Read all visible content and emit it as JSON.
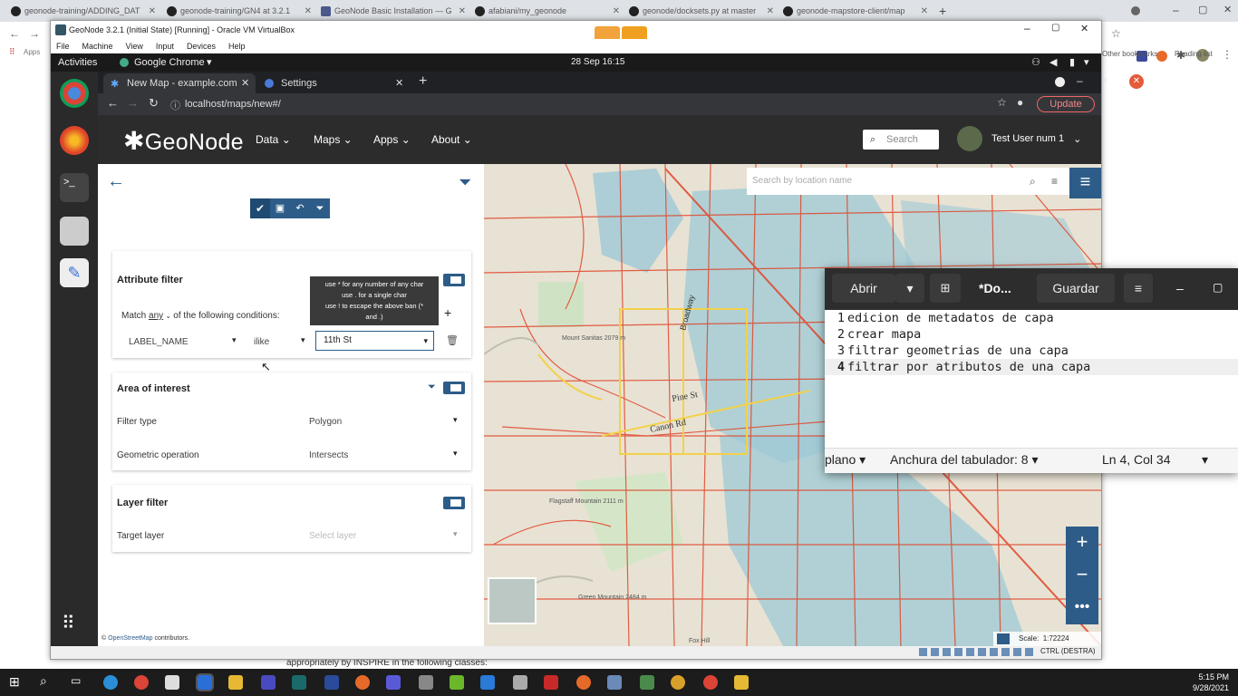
{
  "outer_tabs": [
    {
      "label": "geonode-training/ADDING_DAT"
    },
    {
      "label": "geonode-training/GN4 at 3.2.1"
    },
    {
      "label": "GeoNode Basic Installation — G"
    },
    {
      "label": "afabiani/my_geonode"
    },
    {
      "label": "geonode/docksets.py at master"
    },
    {
      "label": "geonode-mapstore-client/map"
    }
  ],
  "outer_bookmarks": {
    "apps": "Apps",
    "other": "Other bookmarks",
    "reading": "Reading list"
  },
  "vbox": {
    "title": "GeoNode 3.2.1 (Initial State) [Running] - Oracle VM VirtualBox",
    "menu": [
      "File",
      "Machine",
      "View",
      "Input",
      "Devices",
      "Help"
    ],
    "host_key": "CTRL (DESTRA)"
  },
  "gnome": {
    "activities": "Activities",
    "app": "Google Chrome",
    "datetime": "28 Sep  16:15"
  },
  "guest_chrome": {
    "tabs": [
      {
        "label": "New Map - example.com"
      },
      {
        "label": "Settings"
      }
    ],
    "url": "localhost/maps/new#/",
    "update": "Update"
  },
  "geonode": {
    "logo": "GeoNode",
    "nav": [
      "Data",
      "Maps",
      "Apps",
      "About"
    ],
    "search_placeholder": "Search",
    "user": "Test User num 1"
  },
  "filter_panel": {
    "attribute_filter": {
      "title": "Attribute filter",
      "match_prefix": "Match",
      "match_value": "any",
      "match_suffix": "of the following conditions:",
      "tooltip": [
        "use * for any number of any char",
        "use . for a single char",
        "use ! to escape the above ban (*",
        "and .)"
      ],
      "row": {
        "attribute": "LABEL_NAME",
        "operator": "ilike",
        "value": "11th St"
      }
    },
    "area_of_interest": {
      "title": "Area of interest",
      "filter_type_label": "Filter type",
      "filter_type_value": "Polygon",
      "geom_op_label": "Geometric operation",
      "geom_op_value": "Intersects"
    },
    "layer_filter": {
      "title": "Layer filter",
      "target_label": "Target layer",
      "target_placeholder": "Select layer"
    }
  },
  "map": {
    "search_placeholder": "Search by location name",
    "attribution_link": "OpenStreetMap",
    "attribution_suffix": " contributors.",
    "attribution_prefix": "©",
    "scale_label": "Scale:",
    "scale_value": "1:72224",
    "labels": [
      "Broadway",
      "Pine St",
      "Canon Rd",
      "Mount Sanitas 2079 m",
      "Flagstaff Mountain 2111 m",
      "Green Mountain 2484 m",
      "Fox Hill"
    ]
  },
  "gedit": {
    "open_label": "Abrir",
    "title": "*Do...",
    "save_label": "Guardar",
    "lines": [
      {
        "n": "1",
        "text": "edicion de metadatos de capa"
      },
      {
        "n": "2",
        "text": "crear mapa"
      },
      {
        "n": "3",
        "text": "filtrar geometrias de una capa"
      },
      {
        "n": "4",
        "text": "filtrar por atributos de una capa"
      }
    ],
    "status_mode": "plano",
    "status_tab": "Anchura del tabulador: 8",
    "status_pos": "Ln 4, Col 34"
  },
  "behind_text": "appropriately by INSPIRE in the following classes:",
  "taskbar": {
    "time": "5:15 PM",
    "date": "9/28/2021"
  },
  "colors": {
    "accent": "#2d5c88",
    "header": "#2c2c2c",
    "gedit_head": "#2d2d2d"
  }
}
